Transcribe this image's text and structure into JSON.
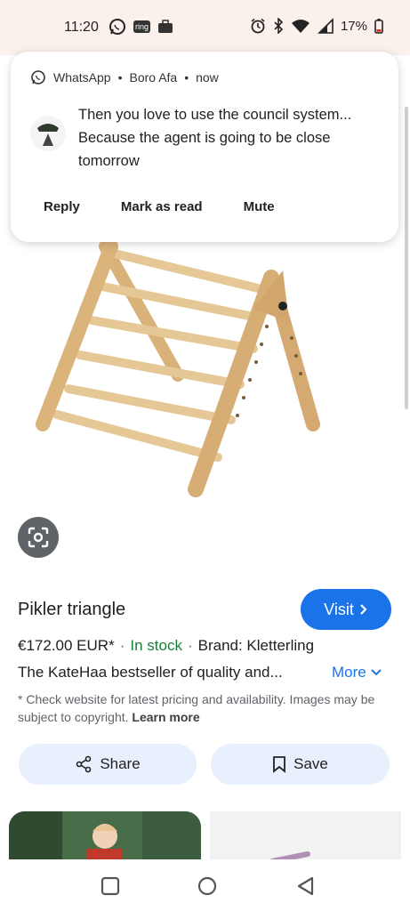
{
  "status_bar": {
    "time": "11:20",
    "ring_label": "ring",
    "battery": "17%"
  },
  "notification": {
    "app": "WhatsApp",
    "sender": "Boro Afa",
    "when": "now",
    "message": "Then you love to use the council system... Because the agent is going to be close tomorrow",
    "actions": [
      "Reply",
      "Mark as read",
      "Mute"
    ]
  },
  "product": {
    "title": "Pikler triangle",
    "visit_label": "Visit",
    "price": "€172.00 EUR*",
    "stock": "In stock",
    "brand": "Brand: Kletterling",
    "description": "The KateHaa bestseller of quality and...",
    "more_label": "More",
    "disclaimer": "* Check website for latest pricing and availability. Images may be subject to copyright.",
    "learn_more": "Learn more"
  },
  "buttons": {
    "share": "Share",
    "save": "Save"
  },
  "colors": {
    "accent": "#1a73e8",
    "in_stock": "#188038",
    "pill_bg": "#e8f0fe",
    "status_bg": "#fbf1ec"
  },
  "icons": [
    "whatsapp-icon",
    "ring-icon",
    "briefcase-icon",
    "alarm-icon",
    "bluetooth-icon",
    "wifi-icon",
    "signal-icon",
    "battery-icon",
    "lens-icon",
    "share-icon",
    "bookmark-icon",
    "chevron-right-icon",
    "chevron-down-icon",
    "recents-icon",
    "home-icon",
    "back-icon"
  ]
}
